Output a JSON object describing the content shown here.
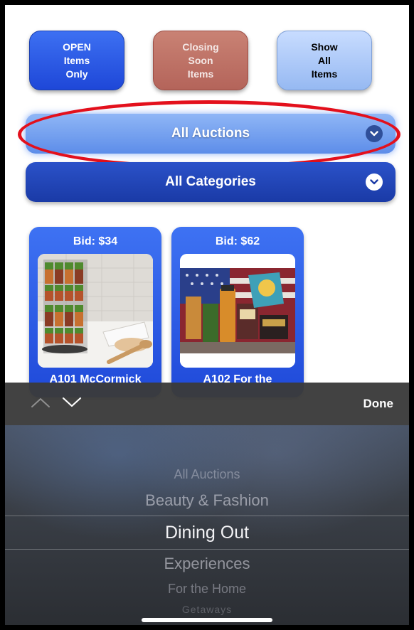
{
  "filters": {
    "open": "OPEN\nItems\nOnly",
    "closing": "Closing\nSoon\nItems",
    "show_all": "Show\nAll\nItems"
  },
  "dropdowns": {
    "auctions_label": "All Auctions",
    "categories_label": "All Categories"
  },
  "items": [
    {
      "bid": "Bid: $34",
      "title": "A101 McCormick"
    },
    {
      "bid": "Bid: $62",
      "title": "A102 For the"
    }
  ],
  "picker": {
    "done_label": "Done",
    "options": [
      "All Auctions",
      "Beauty & Fashion",
      "Dining Out",
      "Experiences",
      "For the Home",
      "Getaways"
    ],
    "selected": "Dining Out"
  },
  "colors": {
    "accent_blue": "#2a5be6",
    "closing_red": "#b9695e",
    "highlight_ring": "#e3101c"
  }
}
